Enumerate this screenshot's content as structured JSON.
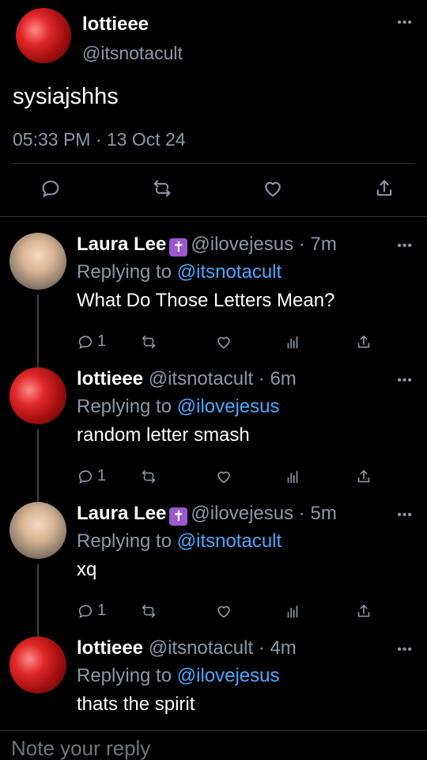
{
  "main_tweet": {
    "name": "lottieee",
    "handle": "@itsnotacult",
    "text": "sysiajshhs",
    "time": "05:33 PM · 13 Oct 24"
  },
  "replies": [
    {
      "name": "Laura Lee",
      "badge": "✝",
      "meta": "@ilovejesus · 7m",
      "replying_prefix": "Replying to",
      "replying_to": "@itsnotacult",
      "text": "What Do Those Letters Mean?",
      "reply_count": "1",
      "avatar": "laura"
    },
    {
      "name": "lottieee",
      "badge": "",
      "meta": "@itsnotacult · 6m",
      "replying_prefix": "Replying to",
      "replying_to": "@ilovejesus",
      "text": "random letter smash",
      "reply_count": "1",
      "avatar": "lottie"
    },
    {
      "name": "Laura Lee",
      "badge": "✝",
      "meta": "@ilovejesus · 5m",
      "replying_prefix": "Replying to",
      "replying_to": "@itsnotacult",
      "text": "xq",
      "reply_count": "1",
      "avatar": "laura"
    },
    {
      "name": "lottieee",
      "badge": "",
      "meta": "@itsnotacult · 4m",
      "replying_prefix": "Replying to",
      "replying_to": "@ilovejesus",
      "text": "thats the spirit",
      "reply_count": "",
      "avatar": "lottie"
    }
  ],
  "compose": {
    "placeholder": "Note your reply"
  },
  "colors": {
    "background": "#000000",
    "secondary_text": "#8b98a5",
    "link": "#4aa8ff",
    "badge": "#9b59d0"
  }
}
